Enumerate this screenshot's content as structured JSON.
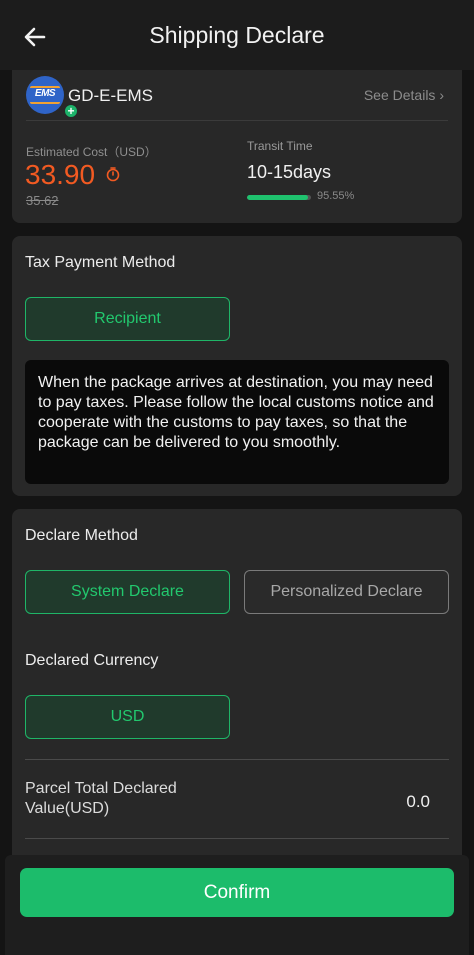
{
  "header": {
    "title": "Shipping Declare",
    "back_icon": "arrow-left-icon"
  },
  "carrier": {
    "name": "GD-E-EMS",
    "logo_text": "EMS",
    "see_details": "See Details",
    "estimated_cost_label": "Estimated Cost（USD）",
    "price": "33.90",
    "old_price": "35.62",
    "transit_label": "Transit Time",
    "transit_value": "10-15days",
    "on_time_percent": "95.55%",
    "on_time_fraction": 0.9555
  },
  "tax": {
    "title": "Tax Payment Method",
    "option": "Recipient",
    "notice": "When the package arrives at destination, you may need to pay taxes. Please follow the local customs notice and cooperate with the customs to pay taxes, so that the package can be delivered to you smoothly."
  },
  "declare": {
    "method_title": "Declare Method",
    "options": [
      "System Declare",
      "Personalized Declare"
    ],
    "selected": "System Declare",
    "currency_title": "Declared Currency",
    "currency": "USD",
    "total_label": "Parcel Total Declared Value(USD)",
    "total_value": "0.0"
  },
  "footer": {
    "confirm_label": "Confirm"
  },
  "colors": {
    "accent": "#1cbc6b",
    "price": "#f25a22",
    "background": "#141414",
    "card": "#282828"
  }
}
